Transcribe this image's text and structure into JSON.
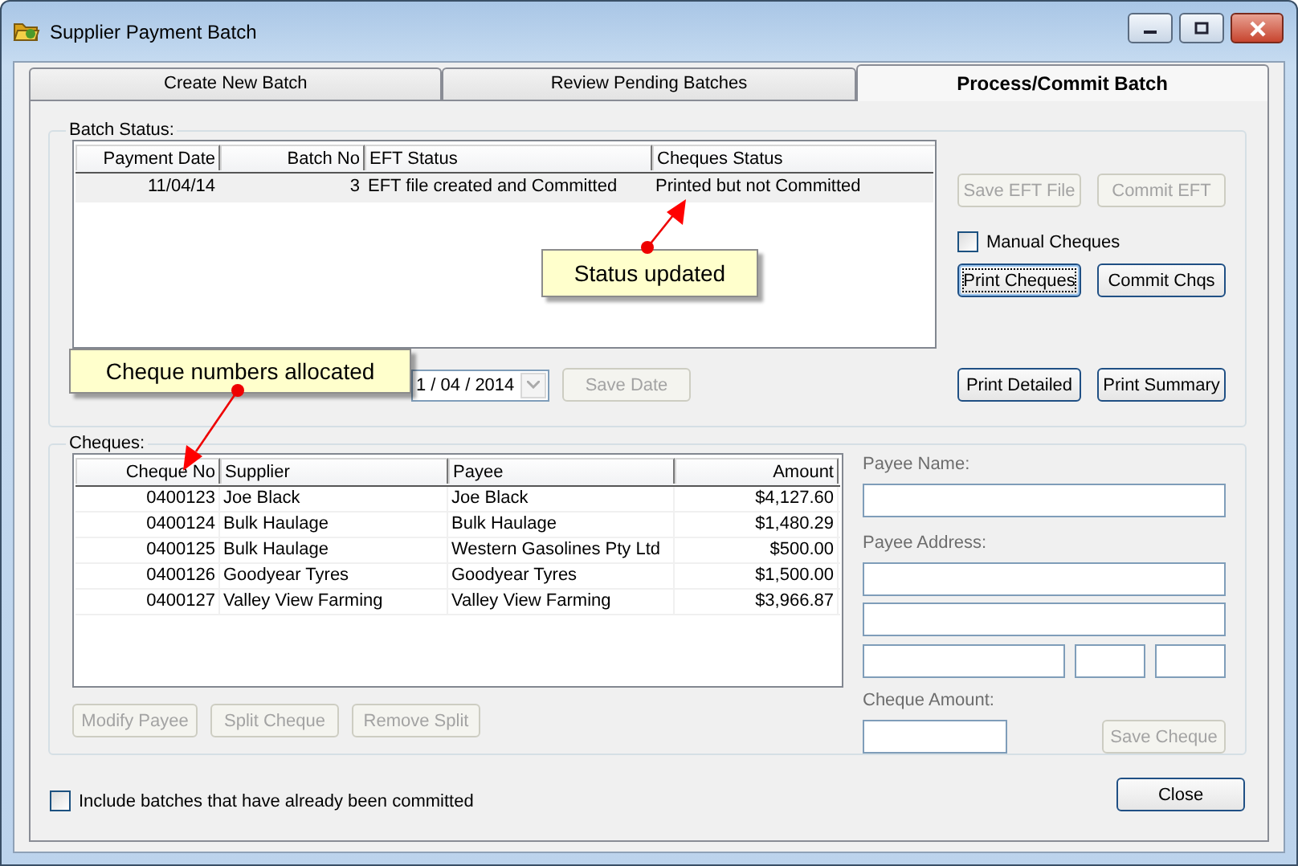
{
  "window": {
    "title": "Supplier Payment Batch"
  },
  "tabs": [
    {
      "label": "Create New Batch",
      "selected": false
    },
    {
      "label": "Review Pending Batches",
      "selected": false
    },
    {
      "label": "Process/Commit Batch",
      "selected": true
    }
  ],
  "batch_status": {
    "title": "Batch Status:",
    "table": {
      "columns": [
        "Payment Date",
        "Batch No",
        "EFT Status",
        "Cheques Status"
      ],
      "rows": [
        {
          "cells": [
            "11/04/14",
            "3",
            "EFT file created and Committed",
            "Printed but not Committed"
          ]
        }
      ]
    },
    "eft_buttons": [
      {
        "label": "Save EFT File",
        "disabled": true,
        "focused": false
      },
      {
        "label": "Commit EFT",
        "disabled": true,
        "focused": false
      }
    ],
    "manual_cheques": {
      "label": "Manual Cheques",
      "checked": false
    },
    "cheque_buttons": [
      {
        "label": "Print Cheques",
        "disabled": false,
        "focused": true
      },
      {
        "label": "Commit Chqs",
        "disabled": false,
        "focused": false
      }
    ],
    "date_field": {
      "value": "1 / 04 / 2014"
    },
    "save_date": {
      "label": "Save Date",
      "disabled": true,
      "focused": false
    },
    "report_buttons": [
      {
        "label": "Print Detailed",
        "disabled": false,
        "focused": false
      },
      {
        "label": "Print Summary",
        "disabled": false,
        "focused": false
      }
    ]
  },
  "cheques": {
    "title": "Cheques:",
    "table": {
      "columns": [
        "Cheque No",
        "Supplier",
        "Payee",
        "Amount"
      ],
      "rows": [
        {
          "cells": [
            "0400123",
            "Joe Black",
            "Joe Black",
            "$4,127.60"
          ]
        },
        {
          "cells": [
            "0400124",
            "Bulk Haulage",
            "Bulk Haulage",
            "$1,480.29"
          ]
        },
        {
          "cells": [
            "0400125",
            "Bulk Haulage",
            "Western Gasolines Pty Ltd",
            "$500.00"
          ]
        },
        {
          "cells": [
            "0400126",
            "Goodyear Tyres",
            "Goodyear Tyres",
            "$1,500.00"
          ]
        },
        {
          "cells": [
            "0400127",
            "Valley View Farming",
            "Valley View Farming",
            "$3,966.87"
          ]
        }
      ]
    },
    "buttons": [
      {
        "label": "Modify Payee",
        "disabled": true,
        "focused": false
      },
      {
        "label": "Split Cheque",
        "disabled": true,
        "focused": false
      },
      {
        "label": "Remove Split",
        "disabled": true,
        "focused": false
      }
    ],
    "payee_name_label": "Payee Name:",
    "payee_address_label": "Payee Address:",
    "cheque_amount_label": "Cheque Amount:",
    "save_cheque": {
      "label": "Save Cheque",
      "disabled": true,
      "focused": false
    }
  },
  "include_committed": {
    "label": "Include batches that have already been committed",
    "checked": false
  },
  "close_button": {
    "label": "Close",
    "disabled": false,
    "focused": false
  },
  "callouts": [
    {
      "text": "Status updated"
    },
    {
      "text": "Cheque numbers allocated"
    }
  ]
}
